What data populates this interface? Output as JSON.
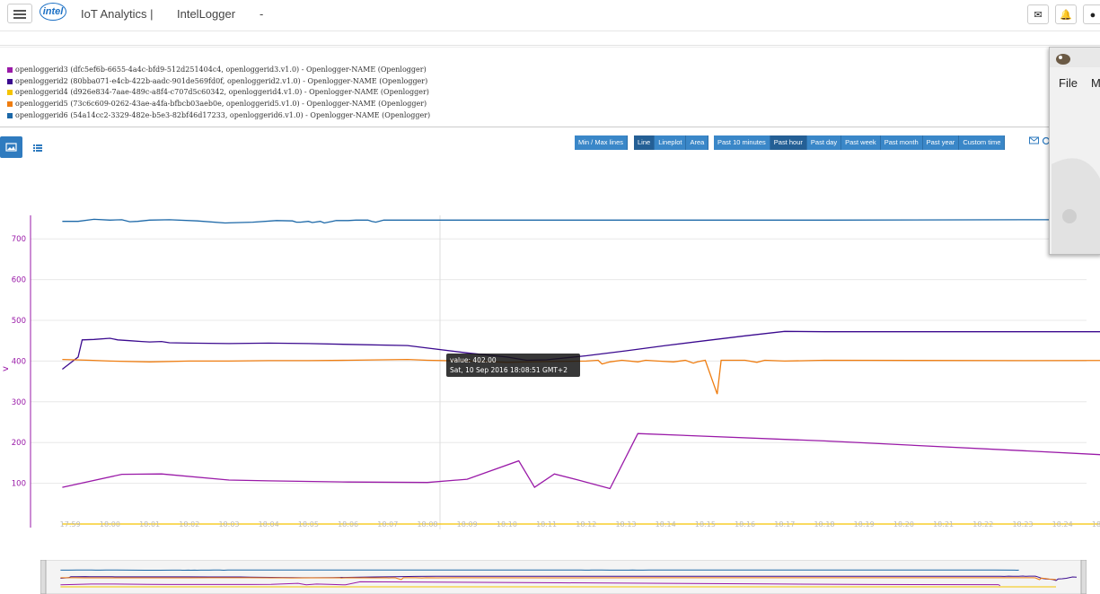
{
  "header": {
    "app_title": "IoT Analytics |",
    "app_subtitle": "IntelLogger",
    "dash": "-",
    "logo_text": "intel",
    "icons": [
      "menu-icon",
      "envelope-icon",
      "bell-icon",
      "user-icon"
    ]
  },
  "legend": [
    {
      "label": "openloggerid3 (dfc5ef6b-6655-4a4c-bfd9-512d251404c4, openloggerid3.v1.0) - Openlogger-NAME (Openlogger)",
      "color": "#9a1aa8"
    },
    {
      "label": "openloggerid2 (80bba071-e4cb-422b-aadc-901de569fd0f, openloggerid2.v1.0) - Openlogger-NAME (Openlogger)",
      "color": "#3b0a8f"
    },
    {
      "label": "openloggerid4 (d926e834-7aae-489c-a8f4-c707d5c60342, openloggerid4.v1.0) - Openlogger-NAME (Openlogger)",
      "color": "#f5c400"
    },
    {
      "label": "openloggerid5 (73c6c609-0262-43ae-a4fa-bfbcb03aeb0e, openloggerid5.v1.0) - Openlogger-NAME (Openlogger)",
      "color": "#ef7d10"
    },
    {
      "label": "openloggerid6 (54a14cc2-3329-482e-b5e3-82bf46d17233, openloggerid6.v1.0) - Openlogger-NAME (Openlogger)",
      "color": "#1c68a8"
    }
  ],
  "toolbar": {
    "minmax": "Min / Max lines",
    "chart_types": [
      "Line",
      "Lineplot",
      "Area"
    ],
    "chart_type_active": "Line",
    "ranges": [
      "Past 10 minutes",
      "Past hour",
      "Past day",
      "Past week",
      "Past month",
      "Past year",
      "Custom time"
    ],
    "range_active": "Past hour"
  },
  "popup": {
    "menu_file": "File",
    "menu_m": "M"
  },
  "tooltip": {
    "line1": "value: 402.00",
    "line2": "Sat, 10 Sep 2016 18:08:51 GMT+2"
  },
  "chart_data": {
    "type": "line",
    "ylabel": "v",
    "ylim": [
      0,
      760
    ],
    "yticks": [
      100,
      200,
      300,
      400,
      500,
      600,
      700
    ],
    "xticks": [
      "17:59",
      "18:00",
      "18:01",
      "18:02",
      "18:03",
      "18:04",
      "18:05",
      "18:06",
      "18:07",
      "18:08",
      "18:09",
      "18:10",
      "18:11",
      "18:12",
      "18:13",
      "18:14",
      "18:15",
      "18:16",
      "18:17",
      "18:18",
      "18:19",
      "18:20",
      "18:21",
      "18:22",
      "18:23",
      "18:24",
      "18:25"
    ],
    "x_unit": "minutes after 17:58",
    "grid": "horizontal",
    "series": [
      {
        "name": "openloggerid6",
        "color": "#1c68a8",
        "points": [
          [
            0.8,
            743
          ],
          [
            1.2,
            743
          ],
          [
            1.6,
            748
          ],
          [
            2.0,
            746
          ],
          [
            2.3,
            747
          ],
          [
            2.5,
            742
          ],
          [
            2.7,
            743
          ],
          [
            3.0,
            746
          ],
          [
            3.5,
            747
          ],
          [
            4.2,
            744
          ],
          [
            4.9,
            739
          ],
          [
            5.6,
            741
          ],
          [
            6.2,
            745
          ],
          [
            6.6,
            744
          ],
          [
            6.7,
            741
          ],
          [
            6.8,
            741
          ],
          [
            7.0,
            743
          ],
          [
            7.1,
            740
          ],
          [
            7.3,
            743
          ],
          [
            7.4,
            739
          ],
          [
            7.6,
            743
          ],
          [
            7.7,
            745
          ],
          [
            7.9,
            745
          ],
          [
            8.0,
            745
          ],
          [
            8.2,
            746
          ],
          [
            8.5,
            746
          ],
          [
            8.6,
            743
          ],
          [
            8.7,
            741
          ],
          [
            8.9,
            746
          ],
          [
            9.1,
            746
          ],
          [
            10,
            746
          ],
          [
            15,
            746
          ],
          [
            20,
            746
          ],
          [
            25,
            747
          ],
          [
            26,
            747
          ],
          [
            26.2,
            744
          ],
          [
            26.4,
            742
          ],
          [
            26.5,
            748
          ],
          [
            27,
            748
          ],
          [
            27.4,
            742
          ],
          [
            27.5,
            743
          ],
          [
            27.7,
            745
          ],
          [
            28,
            745
          ],
          [
            28.3,
            745
          ],
          [
            28.5,
            746
          ],
          [
            28.7,
            745
          ],
          [
            29,
            745
          ],
          [
            29.3,
            748
          ],
          [
            29.5,
            746
          ],
          [
            29.7,
            746
          ],
          [
            30,
            746
          ],
          [
            33,
            747
          ],
          [
            39,
            747
          ],
          [
            46,
            747
          ],
          [
            47,
            745
          ],
          [
            47.1,
            740
          ],
          [
            47.2,
            743
          ]
        ]
      },
      {
        "name": "openloggerid2",
        "color": "#3b0a8f",
        "points": [
          [
            0.8,
            380
          ],
          [
            1.2,
            410
          ],
          [
            1.3,
            452
          ],
          [
            1.6,
            453
          ],
          [
            2.0,
            456
          ],
          [
            2.2,
            452
          ],
          [
            2.5,
            450
          ],
          [
            2.8,
            448
          ],
          [
            3.0,
            447
          ],
          [
            3.3,
            448
          ],
          [
            3.5,
            445
          ],
          [
            4.0,
            444
          ],
          [
            5.0,
            443
          ],
          [
            6.0,
            444
          ],
          [
            7.0,
            443
          ],
          [
            8.0,
            441
          ],
          [
            9.5,
            438
          ],
          [
            10.0,
            432
          ],
          [
            11.0,
            420
          ],
          [
            12.0,
            410
          ],
          [
            12.5,
            402
          ],
          [
            13.0,
            403
          ],
          [
            14.0,
            413
          ],
          [
            15.0,
            425
          ],
          [
            16.0,
            438
          ],
          [
            17.0,
            450
          ],
          [
            18.0,
            462
          ],
          [
            19.0,
            473
          ],
          [
            20.0,
            472
          ],
          [
            26.0,
            472
          ],
          [
            30.0,
            472
          ],
          [
            35.0,
            471
          ],
          [
            40.0,
            471
          ],
          [
            45.0,
            470
          ],
          [
            46.0,
            470
          ],
          [
            46.3,
            470
          ],
          [
            46.5,
            465
          ],
          [
            46.7,
            475
          ],
          [
            46.9,
            470
          ],
          [
            47.2,
            468
          ],
          [
            47.4,
            478
          ],
          [
            47.5,
            467
          ],
          [
            47.7,
            474
          ],
          [
            47.9,
            477
          ],
          [
            48.0,
            477
          ],
          [
            48.1,
            450
          ],
          [
            48.3,
            380
          ],
          [
            48.5,
            350
          ],
          [
            48.8,
            335
          ],
          [
            49.0,
            285
          ],
          [
            49.1,
            350
          ],
          [
            49.3,
            360
          ],
          [
            49.5,
            380
          ],
          [
            49.8,
            440
          ],
          [
            50.0,
            430
          ]
        ]
      },
      {
        "name": "openloggerid5",
        "color": "#ef7d10",
        "points": [
          [
            0.8,
            404
          ],
          [
            1.5,
            402
          ],
          [
            2.0,
            400
          ],
          [
            3.0,
            398
          ],
          [
            4.0,
            400
          ],
          [
            5.0,
            400
          ],
          [
            6.0,
            401
          ],
          [
            7.0,
            401
          ],
          [
            8.0,
            402
          ],
          [
            9.5,
            404
          ],
          [
            10.0,
            402
          ],
          [
            11.0,
            400
          ],
          [
            11.5,
            399
          ],
          [
            12.0,
            397
          ],
          [
            13.0,
            399
          ],
          [
            14.0,
            400
          ],
          [
            14.3,
            402
          ],
          [
            14.4,
            393
          ],
          [
            14.6,
            398
          ],
          [
            14.9,
            402
          ],
          [
            15.3,
            398
          ],
          [
            15.5,
            402
          ],
          [
            15.8,
            400
          ],
          [
            16.2,
            398
          ],
          [
            16.5,
            402
          ],
          [
            16.7,
            395
          ],
          [
            16.8,
            398
          ],
          [
            17.0,
            402
          ],
          [
            17.3,
            319
          ],
          [
            17.4,
            402
          ],
          [
            18.0,
            402
          ],
          [
            18.3,
            397
          ],
          [
            18.5,
            402
          ],
          [
            19.0,
            400
          ],
          [
            20.0,
            402
          ],
          [
            25.0,
            401
          ],
          [
            30.0,
            402
          ],
          [
            35.0,
            402
          ],
          [
            40.0,
            402
          ],
          [
            45.0,
            402
          ],
          [
            46.3,
            402
          ],
          [
            46.5,
            405
          ],
          [
            46.7,
            402
          ],
          [
            47.0,
            402
          ],
          [
            47.4,
            402
          ],
          [
            47.6,
            405
          ],
          [
            47.9,
            402
          ],
          [
            48.0,
            400
          ],
          [
            48.2,
            320
          ],
          [
            48.3,
            390
          ],
          [
            48.5,
            370
          ],
          [
            48.7,
            340
          ],
          [
            48.9,
            330
          ],
          [
            49.0,
            320
          ]
        ]
      },
      {
        "name": "openloggerid3",
        "color": "#9a1aa8",
        "points": [
          [
            0.8,
            90
          ],
          [
            2.3,
            122
          ],
          [
            3.3,
            123
          ],
          [
            5.0,
            108
          ],
          [
            6.0,
            106
          ],
          [
            8.0,
            103
          ],
          [
            10.0,
            102
          ],
          [
            11.0,
            110
          ],
          [
            12.3,
            155
          ],
          [
            12.7,
            90
          ],
          [
            13.2,
            123
          ],
          [
            13.8,
            108
          ],
          [
            14.6,
            87
          ],
          [
            15.3,
            222
          ],
          [
            20.0,
            204
          ],
          [
            25.0,
            180
          ],
          [
            30.0,
            155
          ],
          [
            35.0,
            130
          ],
          [
            40.0,
            106
          ],
          [
            46.2,
            98
          ],
          [
            46.3,
            55
          ]
        ]
      },
      {
        "name": "openloggerid4",
        "color": "#f5c400",
        "points": [
          [
            0.8,
            0
          ],
          [
            49.0,
            0
          ]
        ]
      }
    ]
  }
}
